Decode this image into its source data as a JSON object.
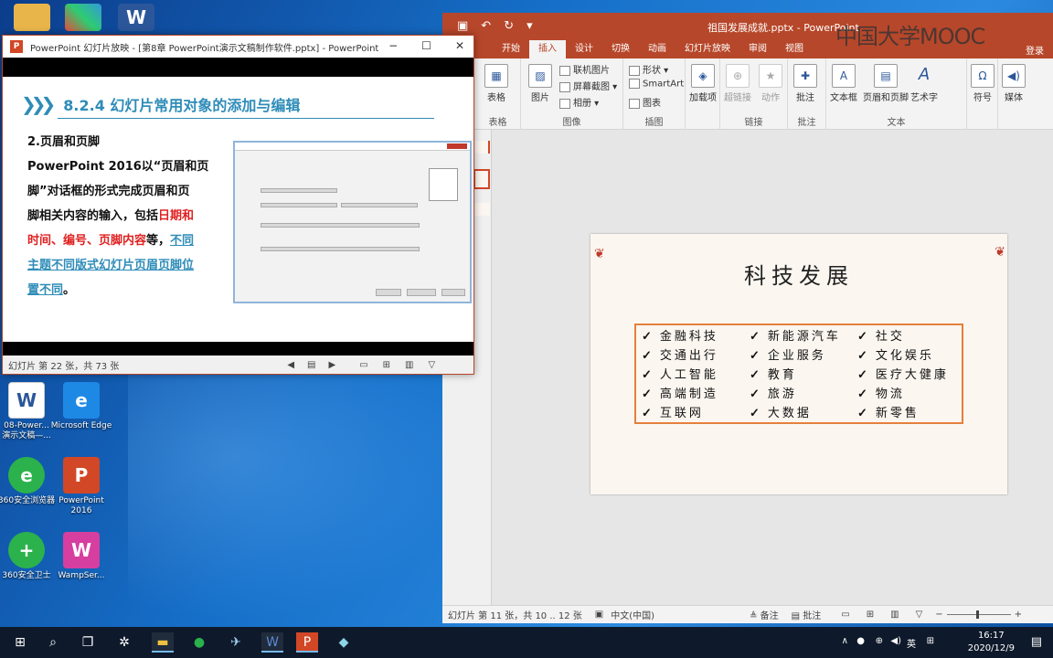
{
  "desktop": {
    "icons": [
      {
        "label": "08-Power...\n演示文稿—...",
        "glyph": "W",
        "color": "#2b579a"
      },
      {
        "label": "Microsoft Edge",
        "glyph": "e",
        "color": "#1e88e5"
      },
      {
        "label": "360安全浏览器",
        "glyph": "e",
        "color": "#2bb24c"
      },
      {
        "label": "PowerPoint 2016",
        "glyph": "P",
        "color": "#d24726"
      },
      {
        "label": "360安全卫士",
        "glyph": "+",
        "color": "#2bb24c"
      },
      {
        "label": "WampSer...",
        "glyph": "W",
        "color": "#d63ea0"
      }
    ]
  },
  "ppt": {
    "doc_title": "祖国发展成就.pptx - PowerPoint",
    "watermark": "中国大学MOOC",
    "login": "登录",
    "tabs": [
      "开始",
      "插入",
      "设计",
      "切换",
      "动画",
      "幻灯片放映",
      "审阅",
      "视图"
    ],
    "active_tab": "插入",
    "ribbon": {
      "tables": {
        "btn": "表格",
        "group": "表格"
      },
      "images": {
        "pictures": "图片",
        "online": "联机图片",
        "screenshot": "屏幕截图",
        "album": "相册",
        "group": "图像"
      },
      "illust": {
        "shapes": "形状",
        "smartart": "SmartArt",
        "chart": "图表",
        "group": "插图"
      },
      "addins": {
        "btn": "加载项"
      },
      "links": {
        "hyperlink": "超链接",
        "action": "动作",
        "group": "链接"
      },
      "comments": {
        "btn": "批注",
        "group": "批注"
      },
      "text": {
        "textbox": "文本框",
        "header": "页眉和页脚",
        "wordart": "艺术字",
        "group": "文本"
      },
      "symbols": {
        "btn": "符号"
      },
      "media": {
        "btn": "媒体"
      }
    },
    "slide": {
      "title": "科技发展",
      "items": [
        "金融科技",
        "新能源汽车",
        "社交",
        "交通出行",
        "企业服务",
        "文化娱乐",
        "人工智能",
        "教育",
        "医疗大健康",
        "高端制造",
        "旅游",
        "物流",
        "互联网",
        "大数据",
        "新零售"
      ]
    },
    "status": {
      "slide_count": "幻灯片 第 11 张，共 10 .. 12 张",
      "lang": "中文(中国)",
      "notes": "备注",
      "comments": "批注"
    }
  },
  "show": {
    "title": "PowerPoint 幻灯片放映 - [第8章 PowerPoint演示文稿制作软件.pptx] - PowerPoint",
    "heading": "8.2.4  幻灯片常用对象的添加与编辑",
    "sub": "2.页眉和页脚",
    "line1": "PowerPoint 2016以“页眉和页",
    "line2": "脚”对话框的形式完成页眉和页",
    "line3": "脚相关内容的输入，包括",
    "red1": "日期和",
    "red2": "时间、编号、页脚内容",
    "after_red": "等，",
    "blue1": "不同",
    "blue2": "主题不同版式幻灯片页眉页脚位",
    "blue3": "置不同",
    "end": "。",
    "status": "幻灯片 第 22 张，共 73 张"
  },
  "taskbar": {
    "time": "16:17",
    "date": "2020/12/9",
    "ime": "英"
  }
}
